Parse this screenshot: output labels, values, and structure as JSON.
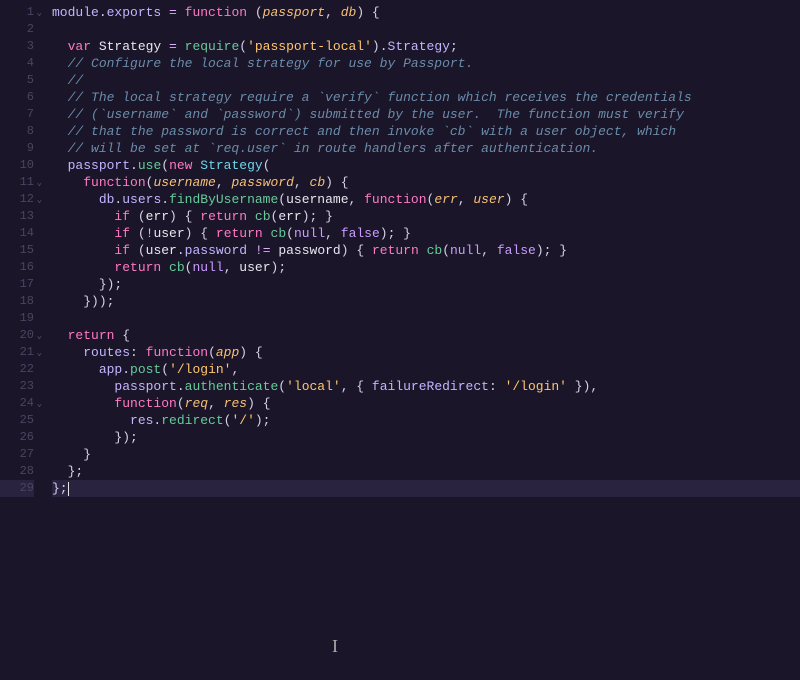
{
  "gutter": {
    "lines": [
      "1",
      "2",
      "3",
      "4",
      "5",
      "6",
      "7",
      "8",
      "9",
      "10",
      "11",
      "12",
      "13",
      "14",
      "15",
      "16",
      "17",
      "18",
      "19",
      "20",
      "21",
      "22",
      "23",
      "24",
      "25",
      "26",
      "27",
      "28",
      "29"
    ],
    "foldable": [
      1,
      11,
      12,
      20,
      21,
      24
    ],
    "active_line": 29
  },
  "code": {
    "module_exports": {
      "module": "module",
      "dot": ".",
      "exports": "exports",
      "eq": " = ",
      "function": "function",
      "open": " (",
      "p1": "passport",
      "c": ", ",
      "p2": "db",
      "close": ") ",
      "brace": "{"
    },
    "l3": {
      "var": "var",
      "sp": " ",
      "name": "Strategy",
      "eq": " = ",
      "req": "require",
      "op": "(",
      "str": "'passport-local'",
      "cp": ")",
      "dot": ".",
      "prop": "Strategy",
      "semi": ";"
    },
    "c4": "// Configure the local strategy for use by Passport.",
    "c5": "//",
    "c6": "// The local strategy require a `verify` function which receives the credentials",
    "c7": "// (`username` and `password`) submitted by the user.  The function must verify",
    "c8": "// that the password is correct and then invoke `cb` with a user object, which",
    "c9": "// will be set at `req.user` in route handlers after authentication.",
    "l10": {
      "obj": "passport",
      "dot": ".",
      "use": "use",
      "op": "(",
      "new": "new",
      "sp": " ",
      "cls": "Strategy",
      "op2": "("
    },
    "l11": {
      "fn": "function",
      "op": "(",
      "p1": "username",
      "c": ", ",
      "p2": "password",
      "c2": ", ",
      "p3": "cb",
      "cp": ") ",
      "br": "{"
    },
    "l12": {
      "db": "db",
      "d1": ".",
      "users": "users",
      "d2": ".",
      "find": "findByUsername",
      "op": "(",
      "arg": "username",
      "c": ", ",
      "fn": "function",
      "op2": "(",
      "p1": "err",
      "c2": ", ",
      "p2": "user",
      "cp": ") ",
      "br": "{"
    },
    "l13": {
      "if": "if",
      "sp": " (",
      "err": "err",
      "cp": ") { ",
      "ret": "return",
      "sp2": " ",
      "cb": "cb",
      "op": "(",
      "arg": "err",
      "cp2": "); }"
    },
    "l14": {
      "if": "if",
      "sp": " (",
      "not": "!",
      "user": "user",
      "cp": ") { ",
      "ret": "return",
      "sp2": " ",
      "cb": "cb",
      "op": "(",
      "null": "null",
      "c": ", ",
      "false": "false",
      "cp2": "); }"
    },
    "l15": {
      "if": "if",
      "sp": " (",
      "user": "user",
      "d": ".",
      "pw": "password",
      "ne": " != ",
      "pw2": "password",
      "cp": ") { ",
      "ret": "return",
      "sp2": " ",
      "cb": "cb",
      "op": "(",
      "null": "null",
      "c": ", ",
      "false": "false",
      "cp2": "); }"
    },
    "l16": {
      "ret": "return",
      "sp": " ",
      "cb": "cb",
      "op": "(",
      "null": "null",
      "c": ", ",
      "user": "user",
      "cp": ");"
    },
    "l17": "});",
    "l18": "}));",
    "l20": {
      "ret": "return",
      "sp": " ",
      "br": "{"
    },
    "l21": {
      "routes": "routes",
      "col": ": ",
      "fn": "function",
      "op": "(",
      "p": "app",
      "cp": ") ",
      "br": "{"
    },
    "l22": {
      "app": "app",
      "d": ".",
      "post": "post",
      "op": "(",
      "str": "'/login'",
      "c": ","
    },
    "l23": {
      "pp": "passport",
      "d": ".",
      "auth": "authenticate",
      "op": "(",
      "str": "'local'",
      "c": ", { ",
      "key": "failureRedirect",
      "col": ": ",
      "str2": "'/login'",
      "cp": " }),"
    },
    "l24": {
      "fn": "function",
      "op": "(",
      "p1": "req",
      "c": ", ",
      "p2": "res",
      "cp": ") ",
      "br": "{"
    },
    "l25": {
      "res": "res",
      "d": ".",
      "redir": "redirect",
      "op": "(",
      "str": "'/'",
      "cp": ");"
    },
    "l26": "});",
    "l27": "}",
    "l28": "};",
    "l29": "};"
  },
  "cursor_glyph": "I"
}
